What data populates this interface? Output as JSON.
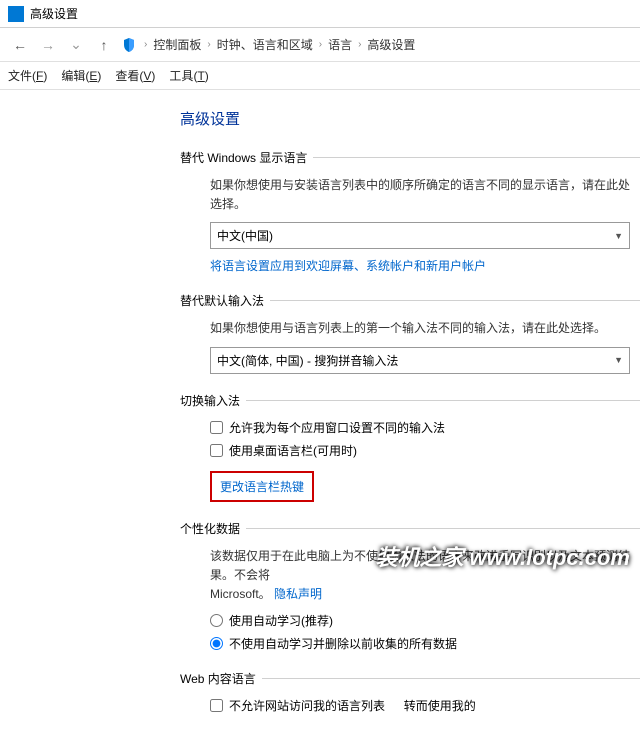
{
  "window": {
    "title": "高级设置"
  },
  "breadcrumb": {
    "items": [
      "控制面板",
      "时钟、语言和区域",
      "语言",
      "高级设置"
    ]
  },
  "menubar": {
    "file": "文件",
    "edit": "编辑",
    "view": "查看",
    "tools": "工具",
    "file_k": "F",
    "edit_k": "E",
    "view_k": "V",
    "tools_k": "T"
  },
  "page": {
    "title": "高级设置"
  },
  "section1": {
    "head": "替代 Windows 显示语言",
    "desc": "如果你想使用与安装语言列表中的顺序所确定的语言不同的显示语言，请在此处选择。",
    "combo": "中文(中国)",
    "link": "将语言设置应用到欢迎屏幕、系统帐户和新用户帐户"
  },
  "section2": {
    "head": "替代默认输入法",
    "desc": "如果你想使用与语言列表上的第一个输入法不同的输入法，请在此处选择。",
    "combo": "中文(简体, 中国) - 搜狗拼音输入法"
  },
  "section3": {
    "head": "切换输入法",
    "cb1": "允许我为每个应用窗口设置不同的输入法",
    "cb2": "使用桌面语言栏(可用时)",
    "link": "更改语言栏热键"
  },
  "section4": {
    "head": "个性化数据",
    "desc": "该数据仅用于在此电脑上为不使用输入法的语言来改进手写识别以及文本预测结果。不会将",
    "desc2": "Microsoft。",
    "privacy": "隐私声明",
    "r1": "使用自动学习(推荐)",
    "r2": "不使用自动学习并删除以前收集的所有数据"
  },
  "section5": {
    "head": "Web 内容语言",
    "cb": "不允许网站访问我的语言列表",
    "tail": "转而使用我的"
  },
  "watermark": "装机之家  www.lotpc.com"
}
